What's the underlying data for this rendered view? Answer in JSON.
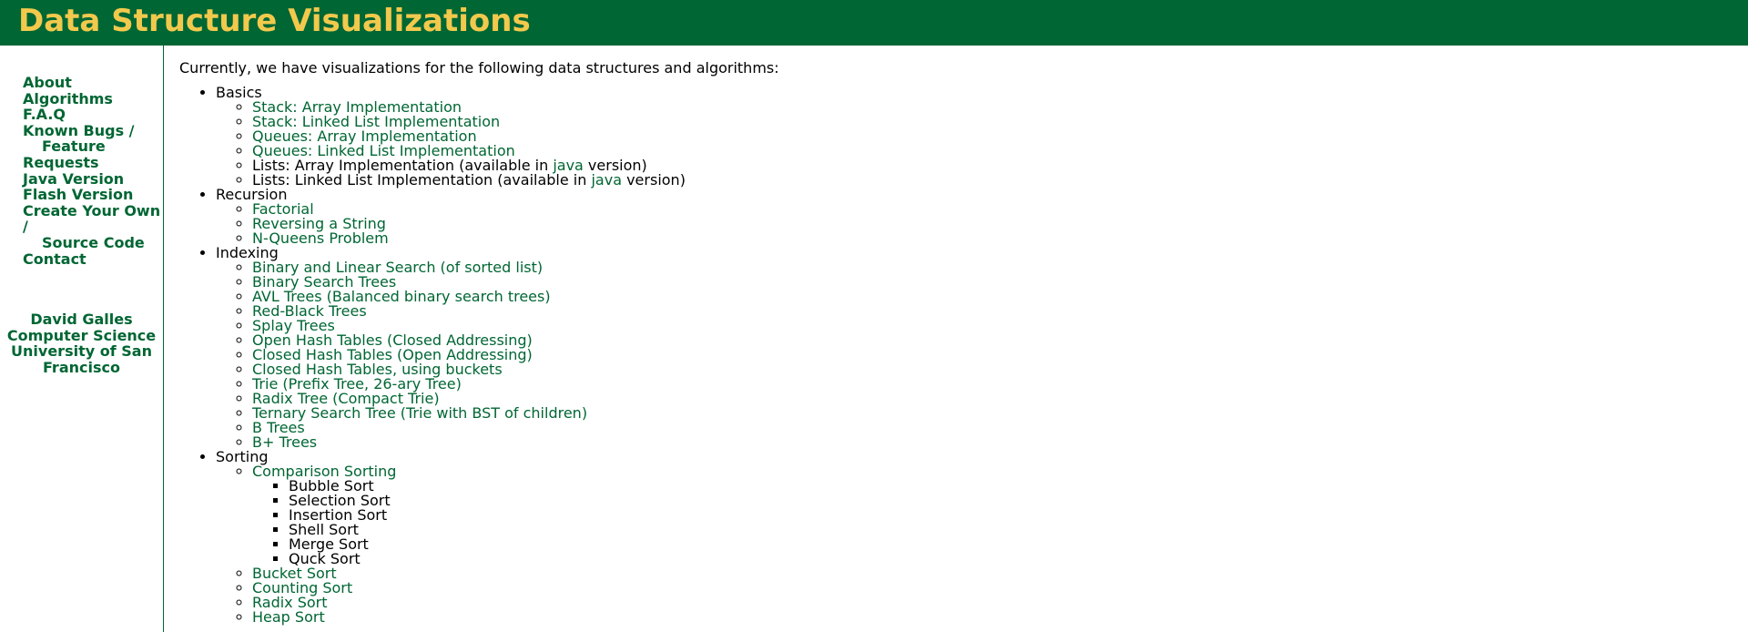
{
  "header": {
    "title": "Data Structure Visualizations"
  },
  "sidebar": {
    "about": "About",
    "algorithms": "Algorithms",
    "faq": "F.A.Q",
    "known_bugs_1": "Known Bugs /",
    "known_bugs_2": "Feature",
    "known_bugs_3": "Requests",
    "java_version": "Java Version",
    "flash_version": "Flash Version",
    "create_1": "Create Your Own",
    "create_2": "/",
    "create_3": "Source Code",
    "contact": "Contact",
    "author_name": "David Galles",
    "author_dept": "Computer Science",
    "author_univ_1": "University of San",
    "author_univ_2": "Francisco"
  },
  "main": {
    "intro": "Currently, we have visualizations for the following data structures and algorithms:",
    "basics": {
      "title": "Basics",
      "stack_array": "Stack: Array Implementation",
      "stack_list": "Stack: Linked List Implementation",
      "queue_array": "Queues: Array Implementation",
      "queue_list": "Queues: Linked List Implementation",
      "lists_array_pre": "Lists: Array Implementation (available in ",
      "lists_list_pre": "Lists: Linked List Implementation (available in ",
      "java": "java",
      "version_post": " version)"
    },
    "recursion": {
      "title": "Recursion",
      "factorial": "Factorial",
      "reversing": "Reversing a String",
      "nqueens": "N-Queens Problem"
    },
    "indexing": {
      "title": "Indexing",
      "items": [
        "Binary and Linear Search (of sorted list)",
        "Binary Search Trees",
        "AVL Trees (Balanced binary search trees)",
        "Red-Black Trees",
        "Splay Trees",
        "Open Hash Tables (Closed Addressing)",
        "Closed Hash Tables (Open Addressing)",
        "Closed Hash Tables, using buckets",
        "Trie (Prefix Tree, 26-ary Tree)",
        "Radix Tree (Compact Trie)",
        "Ternary Search Tree (Trie with BST of children)",
        "B Trees",
        "B+ Trees"
      ]
    },
    "sorting": {
      "title": "Sorting",
      "comparison": "Comparison Sorting",
      "comparison_items": [
        "Bubble Sort",
        "Selection Sort",
        "Insertion Sort",
        "Shell Sort",
        "Merge Sort",
        "Quck Sort"
      ],
      "bucket": "Bucket Sort",
      "counting": "Counting Sort",
      "radix": "Radix Sort",
      "heap": "Heap Sort"
    }
  }
}
